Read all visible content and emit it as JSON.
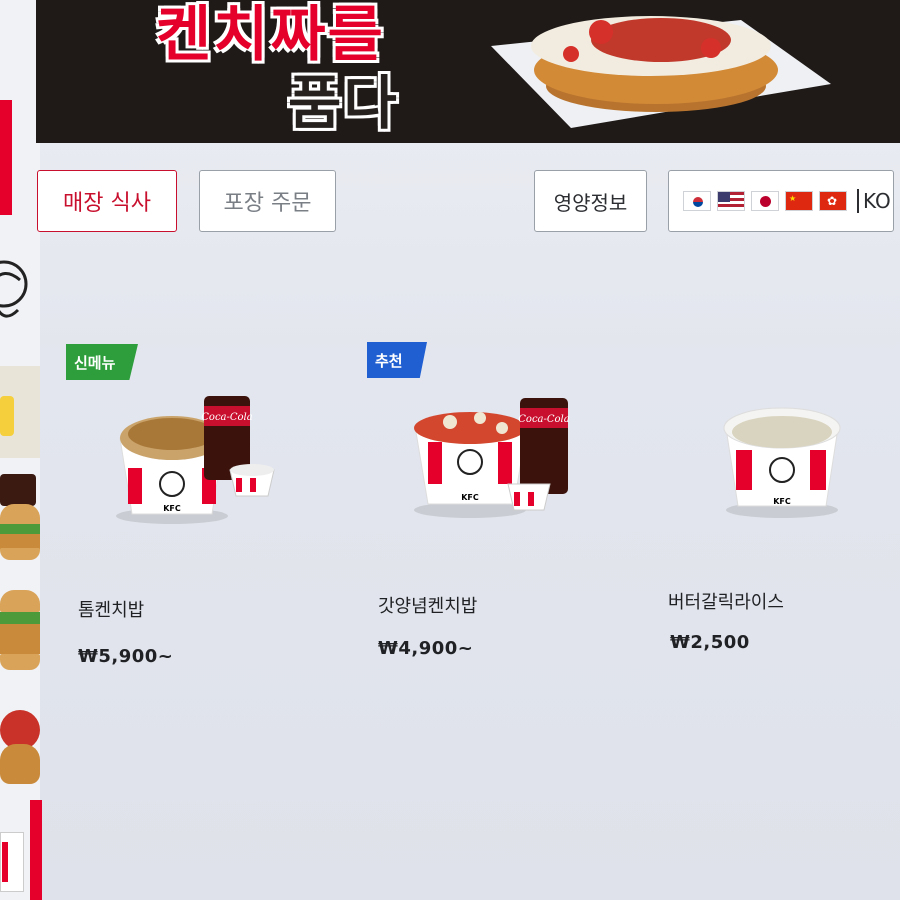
{
  "banner": {
    "title_line1": "켄치짜를",
    "title_line2": "품다"
  },
  "order_mode": {
    "dine_in": "매장 식사",
    "takeout": "포장 주문"
  },
  "nutrition_label": "영양정보",
  "language": {
    "flags": [
      "korea-flag-icon",
      "usa-flag-icon",
      "japan-flag-icon",
      "china-flag-icon",
      "hongkong-flag-icon"
    ],
    "current": "KO"
  },
  "products": [
    {
      "badge": "신메뉴",
      "name": "톰켄치밥",
      "price": "₩5,900~"
    },
    {
      "badge": "추천",
      "name": "갓양념켄치밥",
      "price": "₩4,900~"
    },
    {
      "badge": "",
      "name": "버터갈릭라이스",
      "price": "₩2,500"
    }
  ],
  "colors": {
    "kfc_red": "#e4002b",
    "badge_new": "#2e9e3c",
    "badge_recommended": "#1f5fd1"
  }
}
